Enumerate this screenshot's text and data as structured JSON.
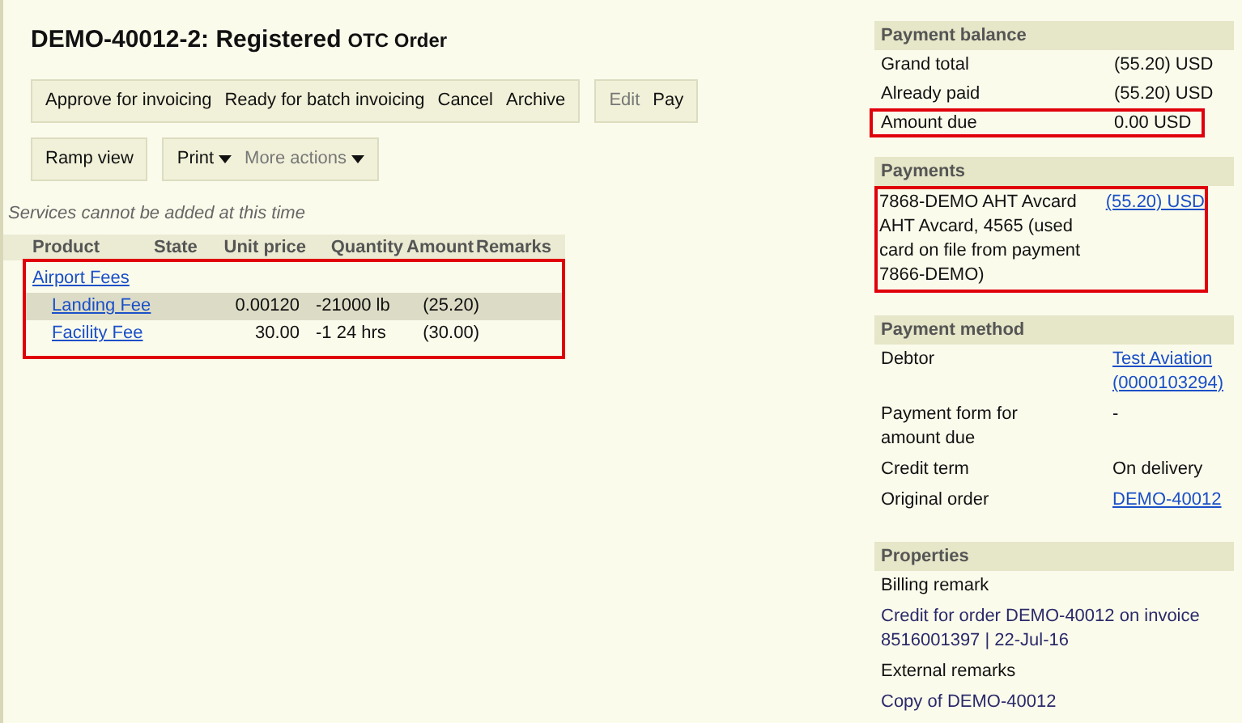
{
  "title": {
    "id": "DEMO-40012-2: Registered",
    "type": "OTC Order"
  },
  "toolbar_rows": [
    [
      {
        "buttons": [
          {
            "label": "Approve for invoicing",
            "disabled": false
          },
          {
            "label": "Ready for batch invoicing",
            "disabled": false
          },
          {
            "label": "Cancel",
            "disabled": false
          },
          {
            "label": "Archive",
            "disabled": false
          }
        ]
      },
      {
        "buttons": [
          {
            "label": "Edit",
            "disabled": true
          },
          {
            "label": "Pay",
            "disabled": false
          }
        ]
      }
    ],
    [
      {
        "buttons": [
          {
            "label": "Ramp view",
            "disabled": false
          }
        ]
      },
      {
        "buttons": [
          {
            "label": "Print",
            "disabled": false,
            "dropdown": true
          },
          {
            "label": "More actions",
            "disabled": true,
            "dropdown": true
          }
        ]
      }
    ]
  ],
  "notice": "Services cannot be added at this time",
  "table": {
    "columns": [
      "Product",
      "State",
      "Unit price",
      "Quantity",
      "Amount",
      "Remarks"
    ],
    "highlighted": true,
    "rows": [
      {
        "kind": "group",
        "product": "Airport Fees",
        "selected": false
      },
      {
        "kind": "item",
        "product": "Landing Fee",
        "unit_price": "0.00120",
        "quantity": "-21000 lb",
        "amount": "(25.20)",
        "selected": true
      },
      {
        "kind": "item",
        "product": "Facility Fee",
        "unit_price": "30.00",
        "quantity": "-1 24 hrs",
        "amount": "(30.00)",
        "selected": false
      }
    ]
  },
  "payment_balance": {
    "title": "Payment balance",
    "rows": [
      {
        "label": "Grand total",
        "value": "(55.20) USD",
        "highlighted": false
      },
      {
        "label": "Already paid",
        "value": "(55.20) USD",
        "highlighted": false
      },
      {
        "label": "Amount due",
        "value": "0.00 USD",
        "highlighted": true
      }
    ]
  },
  "payments": {
    "title": "Payments",
    "items": [
      {
        "description": "7868-DEMO AHT Avcard AHT Avcard, 4565 (used card on file from payment 7866-DEMO)",
        "amount": "(55.20) USD",
        "highlighted": true
      }
    ]
  },
  "payment_method": {
    "title": "Payment method",
    "rows": [
      {
        "label": "Debtor",
        "value": "Test Aviation (0000103294)",
        "link": true
      },
      {
        "label": "Payment form for amount due",
        "value": "-",
        "link": false
      },
      {
        "label": "Credit term",
        "value": "On delivery",
        "link": false
      },
      {
        "label": "Original order",
        "value": "DEMO-40012",
        "link": true
      }
    ]
  },
  "properties": {
    "title": "Properties",
    "entries": [
      {
        "label": "Billing remark",
        "value": "Credit for order DEMO-40012 on invoice 8516001397 | 22-Jul-16"
      },
      {
        "label": "External remarks",
        "value": "Copy of DEMO-40012"
      }
    ]
  }
}
